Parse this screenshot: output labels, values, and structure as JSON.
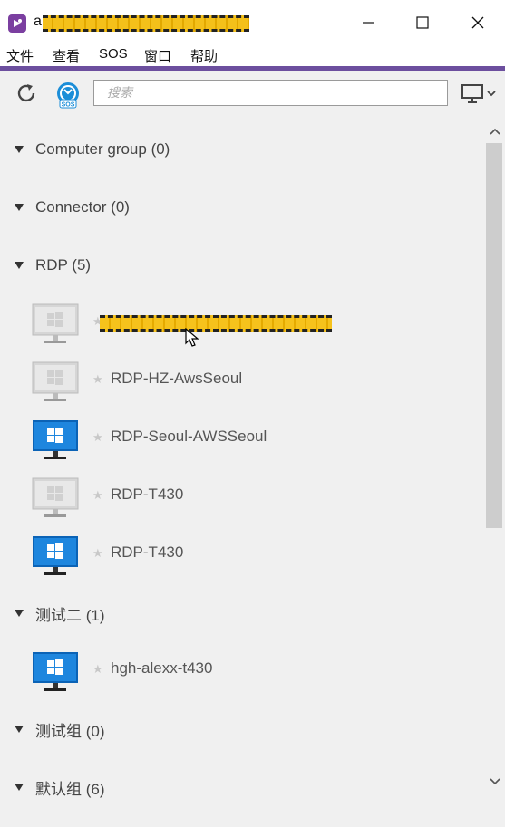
{
  "window": {
    "title_prefix": "a"
  },
  "menu": [
    "文件",
    "查看",
    "SOS",
    "窗口",
    "帮助"
  ],
  "search": {
    "placeholder": "搜索"
  },
  "groups": [
    {
      "label": "Computer group (0)"
    },
    {
      "label": "Connector (0)"
    },
    {
      "label": "RDP (5)"
    },
    {
      "label": "测试二 (1)"
    },
    {
      "label": "测试组 (0)"
    },
    {
      "label": "默认组 (6)"
    }
  ],
  "devices": [
    {
      "name": "",
      "status": "offline",
      "redacted": true
    },
    {
      "name": "RDP-HZ-AwsSeoul",
      "status": "offline"
    },
    {
      "name": "RDP-Seoul-AWSSeoul",
      "status": "online"
    },
    {
      "name": "RDP-T430",
      "status": "offline"
    },
    {
      "name": "RDP-T430",
      "status": "online"
    },
    {
      "name": "hgh-alexx-t430",
      "status": "online"
    }
  ],
  "colors": {
    "accent": "#6c4f9e",
    "online": "#1e7fd8",
    "offline": "#cfcfcf",
    "redaction": "#f4c01a"
  }
}
